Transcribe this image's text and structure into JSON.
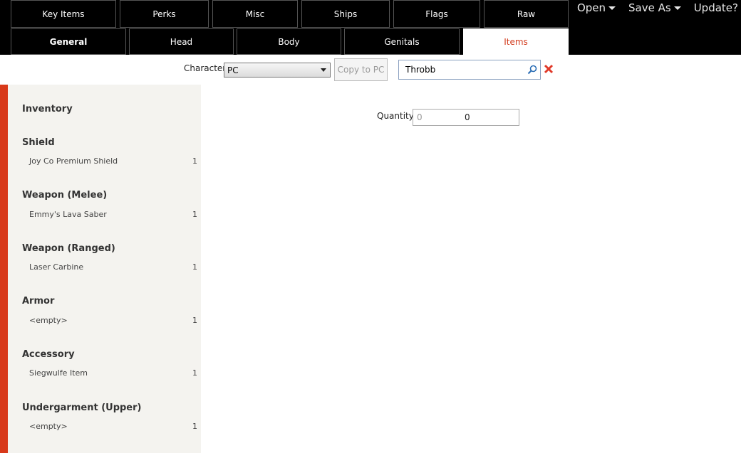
{
  "tabs_row1": [
    "Key Items",
    "Perks",
    "Misc",
    "Ships",
    "Flags",
    "Raw"
  ],
  "tabs_row2": [
    "General",
    "Head",
    "Body",
    "Genitals",
    "Items"
  ],
  "menu": {
    "open": "Open",
    "save_as": "Save As",
    "update": "Update?"
  },
  "toolbar": {
    "character_label": "Character",
    "character_value": "PC",
    "copy_button": "Copy to PC",
    "search_value": "Throbb"
  },
  "sidebar": {
    "inventory": "Inventory",
    "sections": [
      {
        "heading": "Shield",
        "item": "Joy Co Premium Shield",
        "count": "1"
      },
      {
        "heading": "Weapon (Melee)",
        "item": "Emmy's Lava Saber",
        "count": "1"
      },
      {
        "heading": "Weapon (Ranged)",
        "item": "Laser Carbine",
        "count": "1"
      },
      {
        "heading": "Armor",
        "item": "<empty>",
        "count": "1"
      },
      {
        "heading": "Accessory",
        "item": "Siegwulfe Item",
        "count": "1"
      },
      {
        "heading": "Undergarment (Upper)",
        "item": "<empty>",
        "count": "1"
      }
    ]
  },
  "quantity": {
    "label": "Quantity",
    "placeholder": "0",
    "value": "0"
  },
  "colors": {
    "accent": "#d8391a",
    "selected_tab_text": "#d23c1e",
    "sidebar_bg": "#f4f3ef",
    "topbar_bg": "#000000"
  }
}
